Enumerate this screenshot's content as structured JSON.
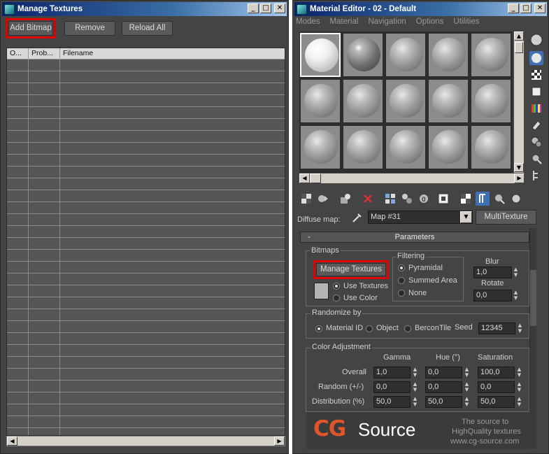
{
  "left_window": {
    "title": "Manage Textures",
    "buttons": {
      "add_bitmap": "Add Bitmap",
      "remove": "Remove",
      "reload_all": "Reload All"
    },
    "columns": [
      "O...",
      "Prob...",
      "Filename"
    ]
  },
  "right_window": {
    "title": "Material Editor - 02 - Default",
    "menu": [
      "Modes",
      "Material",
      "Navigation",
      "Options",
      "Utilities"
    ],
    "diffuse_label": "Diffuse map:",
    "map_name": "Map #31",
    "map_type": "MultiTexture",
    "rollout_title": "Parameters",
    "rollout_toggle": "-",
    "bitmaps": {
      "group_title": "Bitmaps",
      "manage_textures_button": "Manage Textures",
      "use_textures": "Use Textures",
      "use_color": "Use Color"
    },
    "filtering": {
      "group_title": "Filtering",
      "pyramidal": "Pyramidal",
      "summed_area": "Summed Area",
      "none": "None"
    },
    "blur": {
      "label": "Blur",
      "value": "1,0"
    },
    "rotate": {
      "label": "Rotate",
      "value": "0,0"
    },
    "randomize": {
      "group_title": "Randomize by",
      "material_id": "Material ID",
      "object": "Object",
      "bercon_tile": "BerconTile",
      "seed_label": "Seed",
      "seed_value": "12345"
    },
    "color_adjustment": {
      "group_title": "Color Adjustment",
      "headers": [
        "Gamma",
        "Hue (°)",
        "Saturation"
      ],
      "rows": [
        {
          "label": "Overall",
          "values": [
            "1,0",
            "0,0",
            "100,0"
          ]
        },
        {
          "label": "Random (+/-)",
          "values": [
            "0,0",
            "0,0",
            "0,0"
          ]
        },
        {
          "label": "Distribution (%)",
          "values": [
            "50,0",
            "50,0",
            "50,0"
          ]
        }
      ]
    },
    "banner": {
      "logo_cg": "CG",
      "logo_source": "Source",
      "tagline1": "The source to",
      "tagline2": "HighQuality textures",
      "url": "www.cg-source.com"
    }
  },
  "colors": {
    "panel_bg": "#444444",
    "highlight_red": "#e00000",
    "titlebar_blue": "#0a246a",
    "brand_orange": "#e0552b"
  }
}
